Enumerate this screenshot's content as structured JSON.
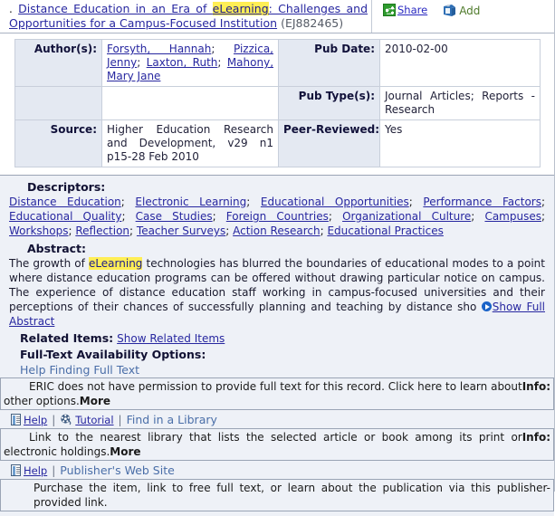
{
  "header": {
    "bullet": ".",
    "title_part1": "Distance Education in an Era of ",
    "title_highlight": "eLearning",
    "title_part2": ": Challenges and Opportunities for a Campus-Focused Institution",
    "eric_id": "(EJ882465)",
    "share_label": "Share",
    "add_label": "Add",
    "share_icon": "share-icon",
    "add_icon": "clipboard-add-icon"
  },
  "meta": {
    "author_label": "Author(s):",
    "authors": [
      "Forsyth, Hannah",
      "Pizzica, Jenny",
      "Laxton, Ruth",
      "Mahony, Mary Jane"
    ],
    "pub_date_label": "Pub Date:",
    "pub_date": "2010-02-00",
    "pub_type_label": "Pub Type(s):",
    "pub_type": "Journal Articles; Reports - Research",
    "source_label": "Source:",
    "source": "Higher Education Research and Development, v29 n1 p15-28 Feb 2010",
    "peer_reviewed_label": "Peer-Reviewed:",
    "peer_reviewed": "Yes"
  },
  "descriptors": {
    "label": "Descriptors:",
    "items": [
      "Distance Education",
      "Electronic Learning",
      "Educational Opportunities",
      "Performance Factors",
      "Educational Quality",
      "Case Studies",
      "Foreign Countries",
      "Organizational Culture",
      "Campuses",
      "Workshops",
      "Reflection",
      "Teacher Surveys",
      "Action Research",
      "Educational Practices"
    ]
  },
  "abstract": {
    "label": "Abstract:",
    "text_part1": "The growth of ",
    "highlight": "eLearning",
    "text_part2": " technologies has blurred the boundaries of educational modes to a point where distance education programs can be offered without drawing particular notice on campus. The experience of distance education staff working in campus-focused universities and their perceptions of their chances of successfully planning and teaching by distance sho ",
    "show_full_label": "Show Full Abstract",
    "show_full_icon": "play-circle-icon"
  },
  "related": {
    "label": "Related Items:",
    "link": "Show Related Items"
  },
  "fulltext": {
    "heading": "Full-Text Availability Options:",
    "help_link": "Help Finding Full Text",
    "options": [
      {
        "description_prefix": "ERIC does not have permission to provide full text for this record. Click here to learn about other options.",
        "more_label": "More",
        "info_label": "Info:",
        "help_label": "Help",
        "help_icon": "document-icon",
        "tutorial_label": "Tutorial",
        "tutorial_icon": "film-reel-icon",
        "action_label": "Find in a Library",
        "action_description": "Link to the nearest library that lists the selected article or book among its print or electronic holdings.",
        "action_more_label": "More",
        "action_info_label": "Info:"
      },
      {
        "help_label": "Help",
        "help_icon": "document-icon",
        "action_label": "Publisher's Web Site",
        "action_description": "Purchase the item, link to free full text, or learn about the publication via this publisher-provided link."
      }
    ]
  },
  "colors": {
    "link": "#2727a0",
    "highlight": "#ffee55",
    "label_bg": "#e4e9f2",
    "body_bg": "#eef1f7",
    "share_green": "#2e9b2e",
    "clipboard_blue": "#2f6fb5"
  }
}
